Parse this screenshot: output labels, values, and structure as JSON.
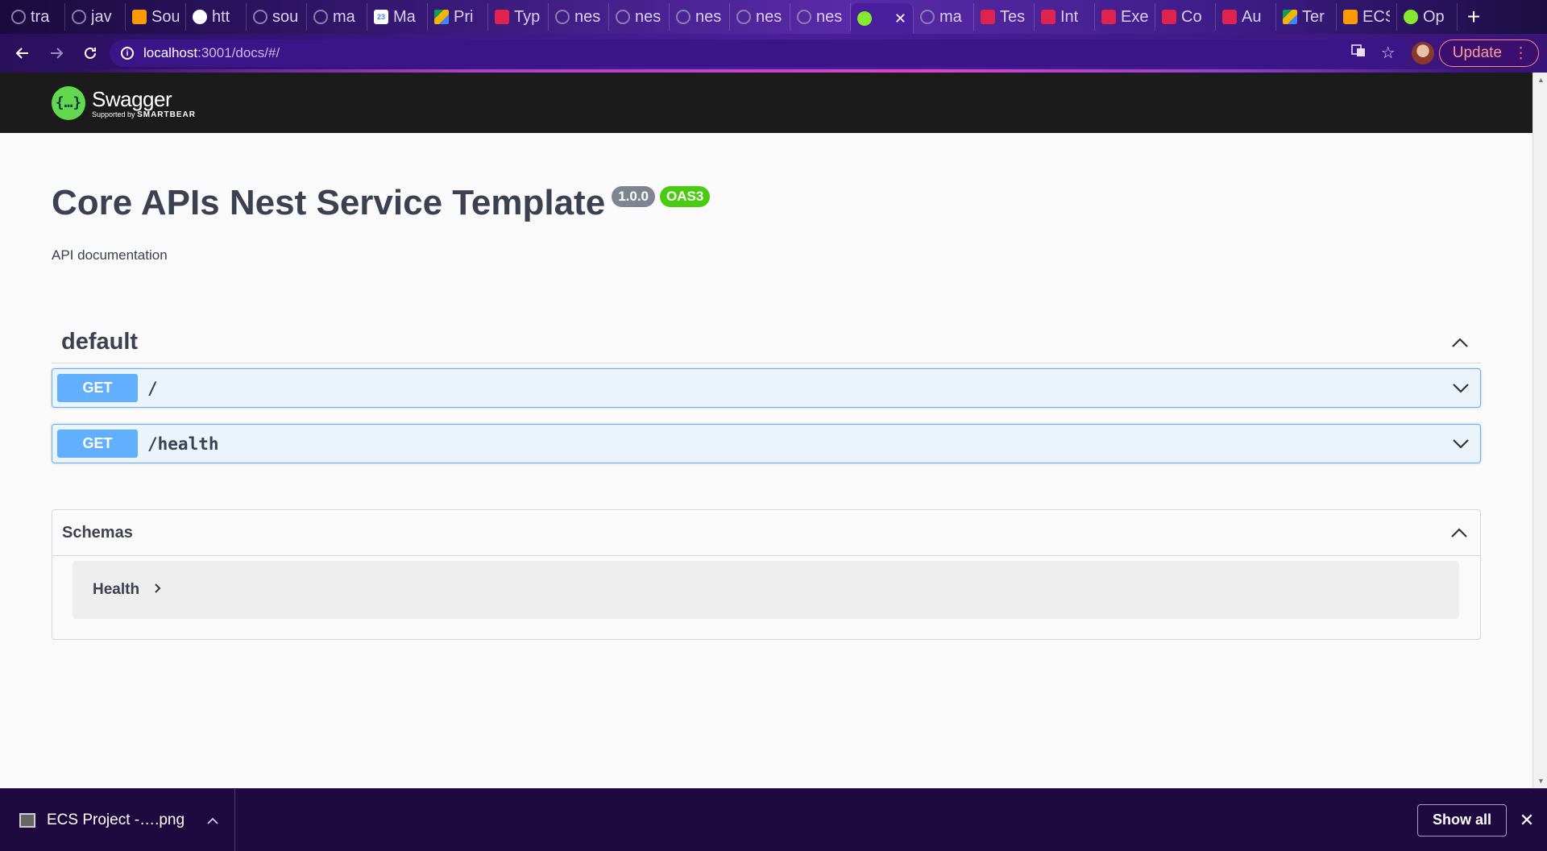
{
  "browser": {
    "tabs": [
      {
        "label": "tra",
        "icon": "github-icon"
      },
      {
        "label": "jav",
        "icon": "github-icon"
      },
      {
        "label": "Sou",
        "icon": "aws-icon"
      },
      {
        "label": "htt",
        "icon": "globe-icon"
      },
      {
        "label": "sou",
        "icon": "github-icon"
      },
      {
        "label": "ma",
        "icon": "github-icon"
      },
      {
        "label": "Ma",
        "icon": "calendar-icon"
      },
      {
        "label": "Pri",
        "icon": "drive-icon"
      },
      {
        "label": "Typ",
        "icon": "nestjs-icon"
      },
      {
        "label": "nes",
        "icon": "github-icon"
      },
      {
        "label": "nes",
        "icon": "github-icon"
      },
      {
        "label": "nes",
        "icon": "github-icon"
      },
      {
        "label": "nes",
        "icon": "github-icon"
      },
      {
        "label": "nes",
        "icon": "github-icon"
      },
      {
        "label": "",
        "icon": "swagger-icon",
        "active": true
      },
      {
        "label": "ma",
        "icon": "github-icon"
      },
      {
        "label": "Tes",
        "icon": "nestjs-icon"
      },
      {
        "label": "Int",
        "icon": "nestjs-icon"
      },
      {
        "label": "Exe",
        "icon": "nestjs-icon"
      },
      {
        "label": "Co",
        "icon": "nestjs-icon"
      },
      {
        "label": "Au",
        "icon": "nestjs-icon"
      },
      {
        "label": "Ter",
        "icon": "drive-icon"
      },
      {
        "label": "ECS",
        "icon": "aws-icon"
      },
      {
        "label": "Op",
        "icon": "swagger-icon"
      }
    ],
    "url_host": "localhost",
    "url_rest": ":3001/docs/#/",
    "update_label": "Update"
  },
  "swagger": {
    "logo_name": "Swagger",
    "logo_sub": "Supported by",
    "logo_sub_brand": "SMARTBEAR",
    "title": "Core APIs Nest Service Template",
    "version": "1.0.0",
    "oas": "OAS3",
    "description": "API documentation",
    "tag": "default",
    "operations": [
      {
        "method": "GET",
        "path": "/"
      },
      {
        "method": "GET",
        "path": "/health"
      }
    ],
    "schemas_title": "Schemas",
    "schemas": [
      "Health"
    ]
  },
  "downloads": {
    "file_name": "ECS Project -….png",
    "show_all": "Show all"
  },
  "colors": {
    "get_method": "#61affe",
    "oas_badge": "#49cc0f",
    "version_badge": "#7d8492",
    "topbar": "#1b1b1b"
  }
}
